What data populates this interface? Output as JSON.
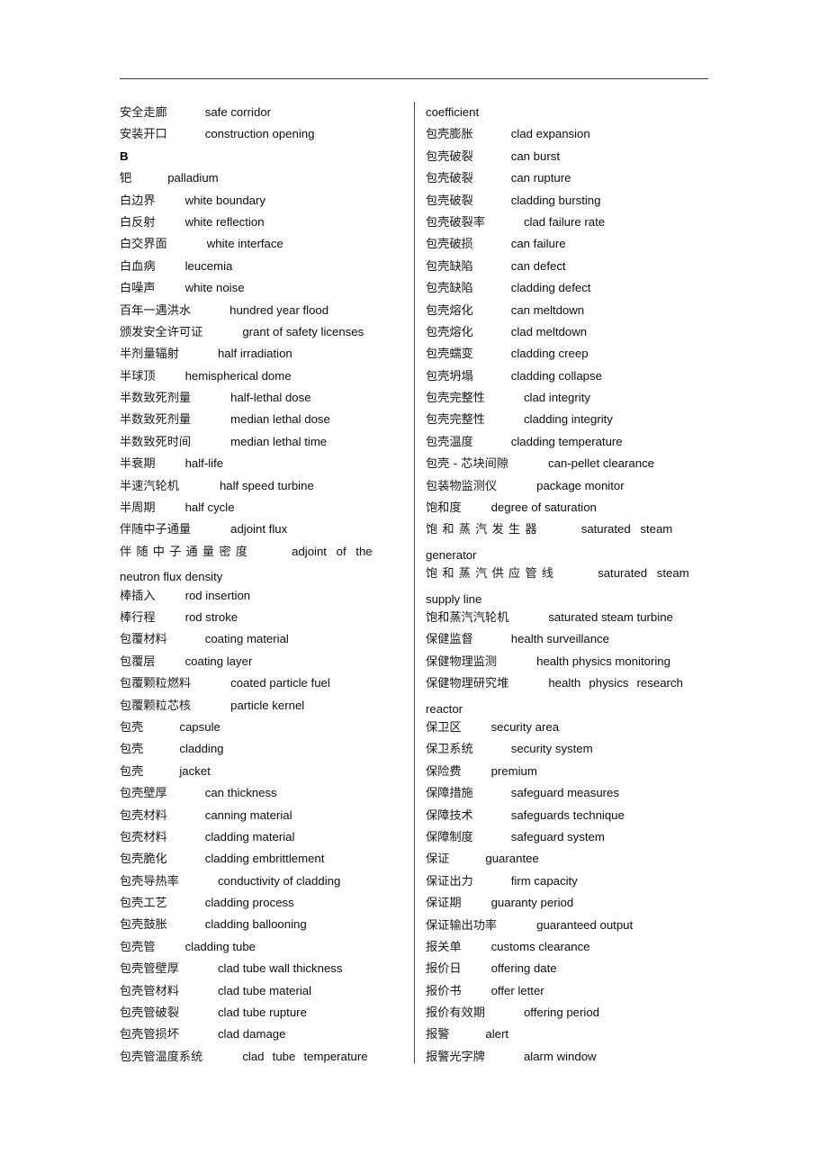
{
  "document": {
    "type": "bilingual-glossary",
    "subject": "nuclear-engineering Chinese-English dictionary page",
    "header_rule": true,
    "column_divider": true
  },
  "left_column": {
    "entries": [
      {
        "zh": "安全走廊",
        "en": "safe corridor",
        "gap": 42
      },
      {
        "zh": "安装开口",
        "en": "construction opening",
        "gap": 42
      },
      {
        "section_letter": "B"
      },
      {
        "zh": "钯",
        "en": "palladium",
        "gap": 40
      },
      {
        "zh": "白边界",
        "en": "white boundary",
        "gap": 33
      },
      {
        "zh": "白反射",
        "en": "white reflection",
        "gap": 33
      },
      {
        "zh": "白交界面",
        "en": "white interface",
        "gap": 44
      },
      {
        "zh": "白血病",
        "en": "leucemia",
        "gap": 33
      },
      {
        "zh": "白噪声",
        "en": "white noise",
        "gap": 33
      },
      {
        "zh": "百年一遇洪水",
        "en": "hundred year flood",
        "gap": 43
      },
      {
        "zh": "颁发安全许可证",
        "en": "grant of safety licenses",
        "gap": 44
      },
      {
        "zh": "半剂量辐射",
        "en": "half irradiation",
        "gap": 43
      },
      {
        "zh": "半球顶",
        "en": "hemispherical dome",
        "gap": 33
      },
      {
        "zh": "半数致死剂量",
        "en": "half-lethal dose",
        "gap": 44
      },
      {
        "zh": "半数致死剂量",
        "en": "median lethal dose",
        "gap": 44
      },
      {
        "zh": "半数致死时间",
        "en": "median lethal time",
        "gap": 44
      },
      {
        "zh": "半衰期",
        "en": "half-life",
        "gap": 33
      },
      {
        "zh": "半速汽轮机",
        "en": "half speed turbine",
        "gap": 45
      },
      {
        "zh": "半周期",
        "en": "half cycle",
        "gap": 33
      },
      {
        "zh": "伴随中子通量",
        "en": "adjoint flux",
        "gap": 44
      },
      {
        "zh": "伴随中子通量密度",
        "en": "adjoint of the",
        "wrap": "neutron flux density",
        "justified": true,
        "gap": 44
      },
      {
        "zh": "棒插入",
        "en": "rod insertion",
        "gap": 33
      },
      {
        "zh": "棒行程",
        "en": "rod stroke",
        "gap": 33
      },
      {
        "zh": "包覆材料",
        "en": "coating material",
        "gap": 42
      },
      {
        "zh": "包覆层",
        "en": "coating layer",
        "gap": 33
      },
      {
        "zh": "包覆颗粒燃料",
        "en": "coated particle fuel",
        "gap": 44
      },
      {
        "zh": "包覆颗粒芯核",
        "en": "particle kernel",
        "gap": 44
      },
      {
        "zh": "包壳",
        "en": "capsule",
        "gap": 40
      },
      {
        "zh": "包壳",
        "en": "cladding",
        "gap": 40
      },
      {
        "zh": "包壳",
        "en": "jacket",
        "gap": 40
      },
      {
        "zh": "包壳壁厚",
        "en": "can thickness",
        "gap": 42
      },
      {
        "zh": "包壳材料",
        "en": "canning material",
        "gap": 42
      },
      {
        "zh": "包壳材料",
        "en": "cladding material",
        "gap": 42
      },
      {
        "zh": "包壳脆化",
        "en": "cladding embrittlement",
        "gap": 42
      },
      {
        "zh": "包壳导热率",
        "en": "conductivity of cladding",
        "gap": 43
      },
      {
        "zh": "包壳工艺",
        "en": "cladding process",
        "gap": 42
      },
      {
        "zh": "包壳鼓胀",
        "en": "cladding ballooning",
        "gap": 42
      },
      {
        "zh": "包壳管",
        "en": "cladding tube",
        "gap": 33
      },
      {
        "zh": "包壳管壁厚",
        "en": "clad tube wall thickness",
        "gap": 43
      },
      {
        "zh": "包壳管材料",
        "en": "clad tube material",
        "gap": 43
      },
      {
        "zh": "包壳管破裂",
        "en": "clad tube rupture",
        "gap": 43
      },
      {
        "zh": "包壳管损坏",
        "en": "clad damage",
        "gap": 43
      },
      {
        "zh": "包壳管温度系统",
        "en": "clad tube temperature",
        "justified2": true,
        "gap": 44
      }
    ]
  },
  "right_column": {
    "continuation_line": "coefficient",
    "entries": [
      {
        "zh": "包壳膨胀",
        "en": "clad expansion",
        "gap": 42
      },
      {
        "zh": "包壳破裂",
        "en": "can burst",
        "gap": 42
      },
      {
        "zh": "包壳破裂",
        "en": "can rupture",
        "gap": 42
      },
      {
        "zh": "包壳破裂",
        "en": "cladding bursting",
        "gap": 42
      },
      {
        "zh": "包壳破裂率",
        "en": "clad failure rate",
        "gap": 43
      },
      {
        "zh": "包壳破损",
        "en": "can failure",
        "gap": 42
      },
      {
        "zh": "包壳缺陷",
        "en": "can defect",
        "gap": 42
      },
      {
        "zh": "包壳缺陷",
        "en": "cladding defect",
        "gap": 42
      },
      {
        "zh": "包壳熔化",
        "en": "can meltdown",
        "gap": 42
      },
      {
        "zh": "包壳熔化",
        "en": "clad meltdown",
        "gap": 42
      },
      {
        "zh": "包壳蠕变",
        "en": "cladding creep",
        "gap": 42
      },
      {
        "zh": "包壳坍塌",
        "en": "cladding collapse",
        "gap": 42
      },
      {
        "zh": "包壳完整性",
        "en": "clad integrity",
        "gap": 43
      },
      {
        "zh": "包壳完整性",
        "en": "cladding integrity",
        "gap": 43
      },
      {
        "zh": "包壳温度",
        "en": "cladding temperature",
        "gap": 42
      },
      {
        "zh": "包壳 - 芯块间隙",
        "en": "can-pellet clearance",
        "gap": 44
      },
      {
        "zh": "包装物监测仪",
        "en": "package monitor",
        "gap": 44
      },
      {
        "zh": "饱和度",
        "en": "degree of saturation",
        "gap": 33
      },
      {
        "zh": "饱和蒸汽发生器",
        "en": "saturated steam",
        "wrap": "generator",
        "justified": true,
        "gap": 44
      },
      {
        "zh": "饱和蒸汽供应管线",
        "en": "saturated steam",
        "wrap": "supply line",
        "justified": true,
        "gap": 44
      },
      {
        "zh": "饱和蒸汽汽轮机",
        "en": "saturated steam turbine",
        "gap": 44
      },
      {
        "zh": "保健监督",
        "en": "health surveillance",
        "gap": 42
      },
      {
        "zh": "保健物理监测",
        "en": "health physics monitoring",
        "gap": 44
      },
      {
        "zh": "保健物理研究堆",
        "en": "health physics research",
        "wrap": "reactor",
        "justified2": true,
        "gap": 44
      },
      {
        "zh": "保卫区",
        "en": "security area",
        "gap": 33
      },
      {
        "zh": "保卫系统",
        "en": "security system",
        "gap": 42
      },
      {
        "zh": "保险费",
        "en": "premium",
        "gap": 33
      },
      {
        "zh": "保障措施",
        "en": "safeguard measures",
        "gap": 42
      },
      {
        "zh": "保障技术",
        "en": "safeguards technique",
        "gap": 42
      },
      {
        "zh": "保障制度",
        "en": "safeguard system",
        "gap": 42
      },
      {
        "zh": "保证",
        "en": "guarantee",
        "gap": 40
      },
      {
        "zh": "保证出力",
        "en": "firm capacity",
        "gap": 42
      },
      {
        "zh": "保证期",
        "en": "guaranty period",
        "gap": 33
      },
      {
        "zh": "保证输出功率",
        "en": "guaranteed output",
        "gap": 44
      },
      {
        "zh": "报关单",
        "en": "customs clearance",
        "gap": 33
      },
      {
        "zh": "报价日",
        "en": "offering date",
        "gap": 33
      },
      {
        "zh": "报价书",
        "en": "offer letter",
        "gap": 33
      },
      {
        "zh": "报价有效期",
        "en": "offering period",
        "gap": 43
      },
      {
        "zh": "报警",
        "en": "alert",
        "gap": 40
      },
      {
        "zh": "报警光字牌",
        "en": "alarm window",
        "gap": 43
      }
    ]
  }
}
